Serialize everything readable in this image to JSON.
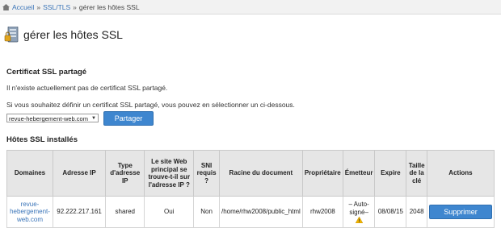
{
  "breadcrumb": {
    "home": "Accueil",
    "sep": "»",
    "level2": "SSL/TLS",
    "current": "gérer les hôtes SSL"
  },
  "page": {
    "title": "gérer les hôtes SSL"
  },
  "shared_cert": {
    "heading": "Certificat SSL partagé",
    "none_text": "Il n'existe actuellement pas de certificat SSL partagé.",
    "select_hint": "Si vous souhaitez définir un certificat SSL partagé, vous pouvez en sélectionner un ci-dessous.",
    "select_value": "revue-hebergement-web.com",
    "share_button": "Partager"
  },
  "installed": {
    "heading": "Hôtes SSL installés",
    "headers": {
      "domains": "Domaines",
      "ip": "Adresse IP",
      "ip_type": "Type d'adresse IP",
      "main_site": "Le site Web principal se trouve-t-il sur l'adresse IP ?",
      "sni": "SNI requis ?",
      "docroot": "Racine du document",
      "owner": "Propriétaire",
      "issuer": "Émetteur",
      "expires": "Expire",
      "keysize": "Taille de la clé",
      "actions": "Actions"
    },
    "row": {
      "domain": "revue-hebergement-web.com",
      "ip": "92.222.217.161",
      "ip_type": "shared",
      "main_site": "Oui",
      "sni": "Non",
      "docroot": "/home/rhw2008/public_html",
      "owner": "rhw2008",
      "issuer": "– Auto-signé–",
      "expires": "08/08/15",
      "keysize": "2048",
      "delete_button": "Supprimer"
    }
  },
  "colors": {
    "accent": "#3e86cf",
    "link": "#3a74b8",
    "warning": "#f0b400"
  },
  "icons": {
    "home": "home-icon",
    "server": "server-lock-icon",
    "warning": "warning-icon"
  }
}
